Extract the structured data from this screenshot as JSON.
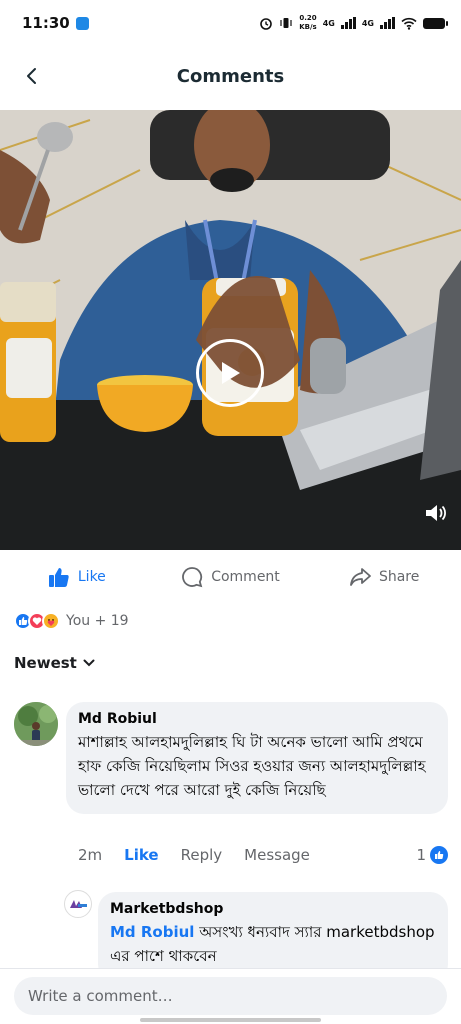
{
  "status_bar": {
    "time": "11:30",
    "net_speed_value": "0.20",
    "net_speed_unit": "KB/s",
    "signal_1": "4G",
    "signal_2": "4G"
  },
  "header": {
    "title": "Comments"
  },
  "post_actions": {
    "like_label": "Like",
    "comment_label": "Comment",
    "share_label": "Share"
  },
  "reactions": {
    "types": [
      "like",
      "love",
      "care"
    ],
    "summary": "You + 19"
  },
  "sort": {
    "label": "Newest"
  },
  "comment": {
    "author": "Md Robiul",
    "text": "মাশাল্লাহ আলহামদুলিল্লাহ ঘি টা অনেক ভালো আমি প্রথমে হাফ কেজি নিয়েছিলাম সিওর হওয়ার জন্য আলহামদুলিল্লাহ ভালো দেখে পরে আরো দুই কেজি নিয়েছি",
    "time": "2m",
    "like_label": "Like",
    "reply_label": "Reply",
    "message_label": "Message",
    "like_count": "1"
  },
  "reply": {
    "author": "Marketbdshop",
    "mention": "Md Robiul",
    "text": " অসংখ্য ধন্যবাদ স্যার marketbdshop এর পাশে থাকবেন"
  },
  "composer": {
    "placeholder": "Write a comment…"
  },
  "colors": {
    "accent": "#1877f2",
    "love": "#f33e58",
    "care": "#f7b125",
    "bubble": "#f0f2f5"
  },
  "icons": [
    "back-arrow-icon",
    "play-icon",
    "volume-icon",
    "like-icon",
    "comment-icon",
    "share-icon",
    "chevron-down-icon"
  ]
}
